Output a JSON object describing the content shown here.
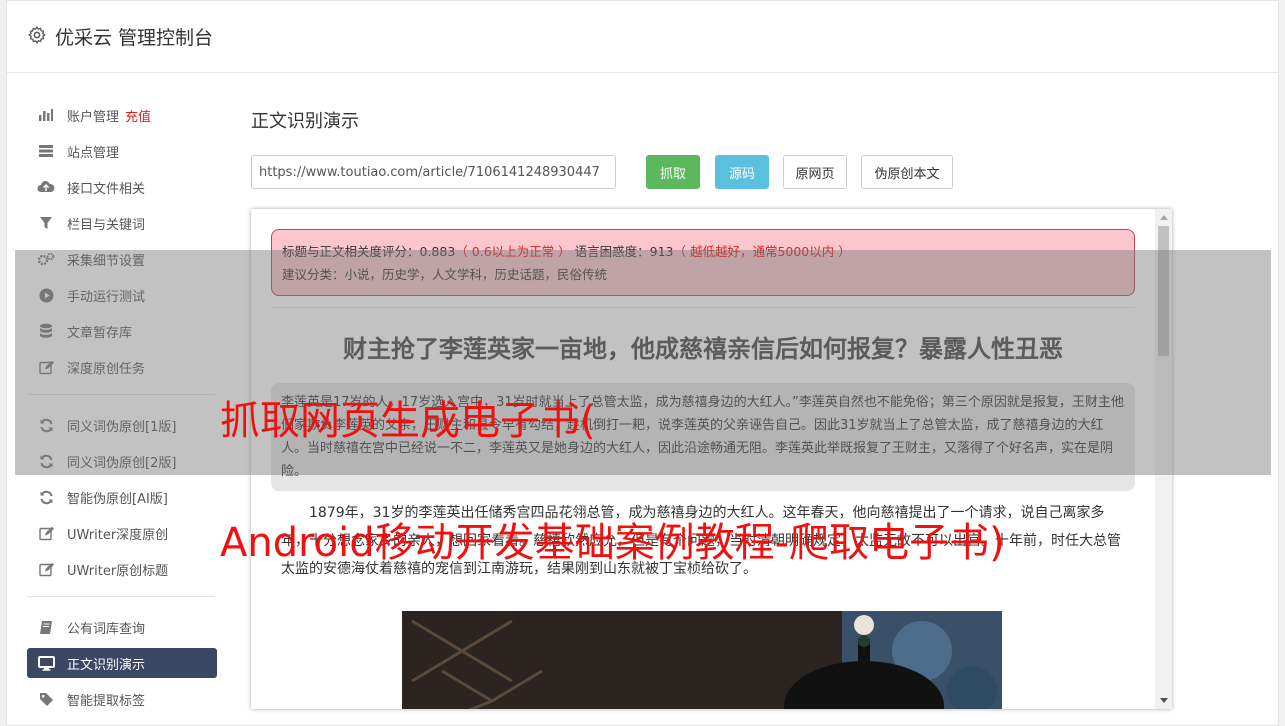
{
  "app": {
    "title": "优采云 管理控制台",
    "icon": "gear-icon"
  },
  "sidebar": {
    "groups": [
      [
        {
          "label": "账户管理",
          "badge": "充值",
          "icon": "bar-chart-icon"
        },
        {
          "label": "站点管理",
          "icon": "server-icon"
        },
        {
          "label": "接口文件相关",
          "icon": "cloud-upload-icon"
        },
        {
          "label": "栏目与关键词",
          "icon": "filter-icon"
        },
        {
          "label": "采集细节设置",
          "icon": "gears-icon"
        },
        {
          "label": "手动运行测试",
          "icon": "play-circle-icon"
        },
        {
          "label": "文章暂存库",
          "icon": "database-icon"
        },
        {
          "label": "深度原创任务",
          "icon": "edit-icon"
        }
      ],
      [
        {
          "label": "同义词伪原创[1版]",
          "icon": "refresh-icon"
        },
        {
          "label": "同义词伪原创[2版]",
          "icon": "refresh-icon"
        },
        {
          "label": "智能伪原创[AI版]",
          "icon": "refresh-icon"
        },
        {
          "label": "UWriter深度原创",
          "icon": "edit-icon"
        },
        {
          "label": "UWriter原创标题",
          "icon": "edit-icon"
        }
      ],
      [
        {
          "label": "公有词库查询",
          "icon": "book-icon"
        },
        {
          "label": "正文识别演示",
          "icon": "monitor-icon",
          "active": true
        },
        {
          "label": "智能提取标签",
          "icon": "tag-icon"
        }
      ]
    ]
  },
  "main": {
    "title": "正文识别演示",
    "url_value": "https://www.toutiao.com/article/7106141248930447",
    "buttons": {
      "fetch": "抓取",
      "source": "源码",
      "original": "原网页",
      "pseudo": "伪原创本文"
    },
    "alert": {
      "relevance_label": "标题与正文相关度评分：0.883",
      "relevance_hint": "（ 0.6以上为正常 ）",
      "perplexity_label": "语言困惑度：913",
      "perplexity_hint": "（ 越低越好，通常5000以内 ）",
      "category": "建议分类：小说，历史学，人文学科，历史话题，民俗传统"
    },
    "article": {
      "title": "财主抢了李莲英家一亩地，他成慈禧亲信后如何报复？暴露人性丑恶",
      "summary": "李莲英是17岁的人，17岁选入宫中，31岁时就当上了总管太监，成为慈禧身边的大红人。”李莲英自然也不能免俗；第三个原因就是报复，王财主他们家欺负李莲英的父亲，王财主和县令早有勾结，趁机倒打一耙，说李莲英的父亲诬告自己。因此31岁就当上了总管太监，成了慈禧身边的大红人。当时慈禧在宫中已经说一不二，李莲英又是她身边的大红人，因此沿途畅通无阻。李莲英此举既报复了王财主，又落得了个好名声，实在是阴险。",
      "paragraph": "1879年，31岁的李莲英出任储秀宫四品花翎总管，成为慈禧身边的大红人。这年春天，他向慈禧提出了一个请求，说自己离家多年，十分想念家乡的亲人，想回家看看。慈禧欣然应允，但是有个问题，当时清朝明确规定，太监无故不可以出宫。十年前，时任大总管太监的安德海仗着慈禧的宠信到江南游玩，结果刚到山东就被丁宝桢给砍了。"
    }
  },
  "overlay": {
    "line1": "抓取网页生成电子书(",
    "line2": "Android移动开发基础案例教程-爬取电子书)"
  }
}
